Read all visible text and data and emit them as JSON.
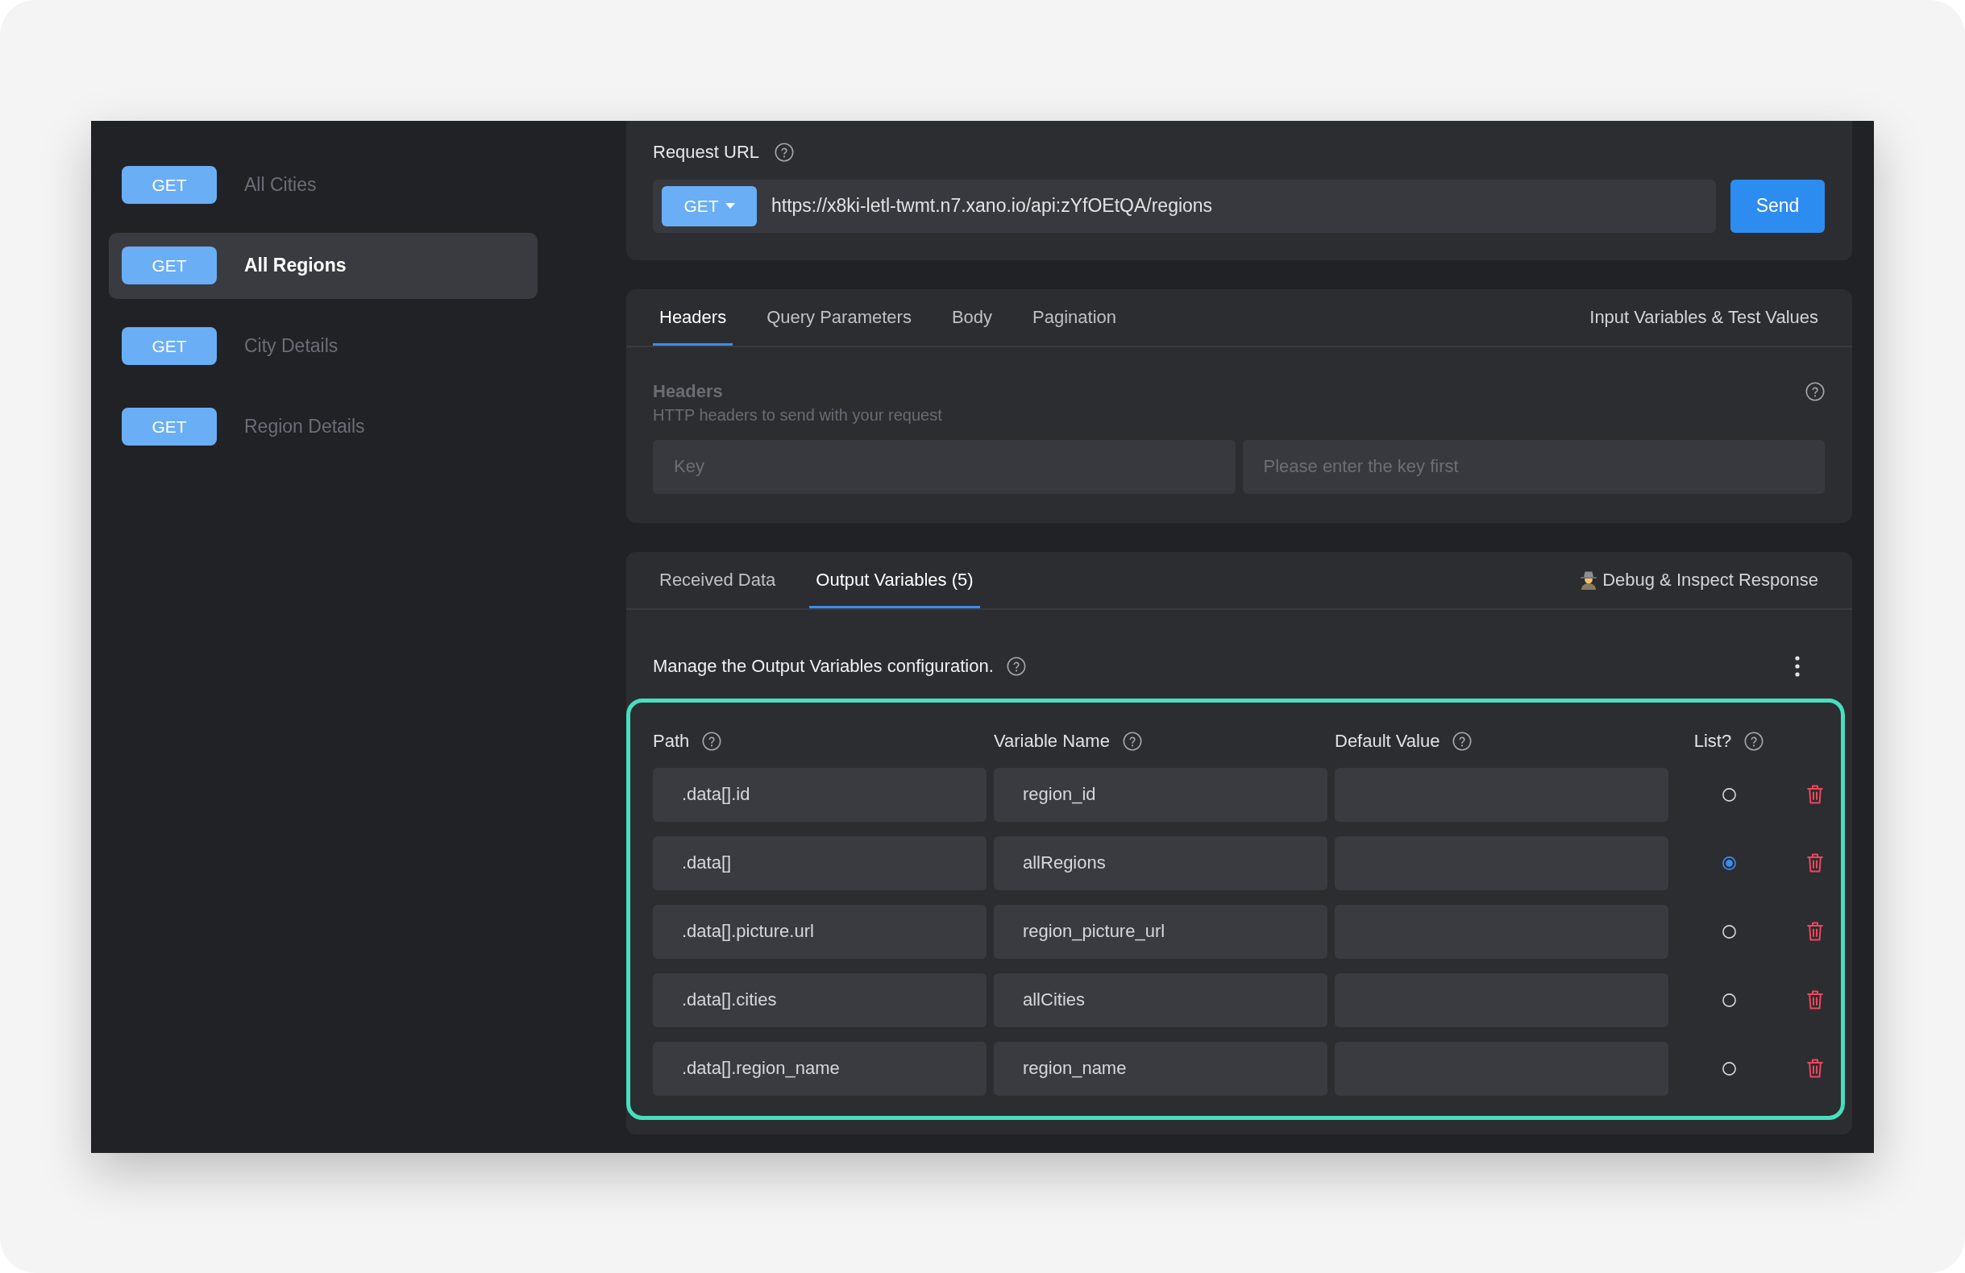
{
  "sidebar": {
    "items": [
      {
        "method": "GET",
        "label": "All Cities",
        "selected": false
      },
      {
        "method": "GET",
        "label": "All Regions",
        "selected": true
      },
      {
        "method": "GET",
        "label": "City Details",
        "selected": false
      },
      {
        "method": "GET",
        "label": "Region Details",
        "selected": false
      }
    ]
  },
  "request": {
    "label": "Request URL",
    "method": "GET",
    "url": "https://x8ki-letl-twmt.n7.xano.io/api:zYfOEtQA/regions",
    "send_button": "Send"
  },
  "request_tabs": {
    "tabs": [
      {
        "label": "Headers",
        "selected": true
      },
      {
        "label": "Query Parameters",
        "selected": false
      },
      {
        "label": "Body",
        "selected": false
      },
      {
        "label": "Pagination",
        "selected": false
      }
    ],
    "link": "Input Variables & Test Values"
  },
  "headers_section": {
    "title": "Headers",
    "subtitle": "HTTP headers to send with your request",
    "key_placeholder": "Key",
    "value_placeholder": "Please enter the key first"
  },
  "response_tabs": {
    "tabs": [
      {
        "label": "Received Data",
        "selected": false
      },
      {
        "label": "Output Variables (5)",
        "selected": true
      }
    ],
    "link": "Debug & Inspect Response"
  },
  "output_variables": {
    "description": "Manage the Output Variables configuration.",
    "columns": [
      "Path",
      "Variable Name",
      "Default Value",
      "List?"
    ],
    "rows": [
      {
        "path": ".data[].id",
        "variable_name": "region_id",
        "list": false
      },
      {
        "path": ".data[]",
        "variable_name": "allRegions",
        "list": true
      },
      {
        "path": ".data[].picture.url",
        "variable_name": "region_picture_url",
        "list": false
      },
      {
        "path": ".data[].cities",
        "variable_name": "allCities",
        "list": false
      },
      {
        "path": ".data[].region_name",
        "variable_name": "region_name",
        "list": false
      }
    ]
  }
}
